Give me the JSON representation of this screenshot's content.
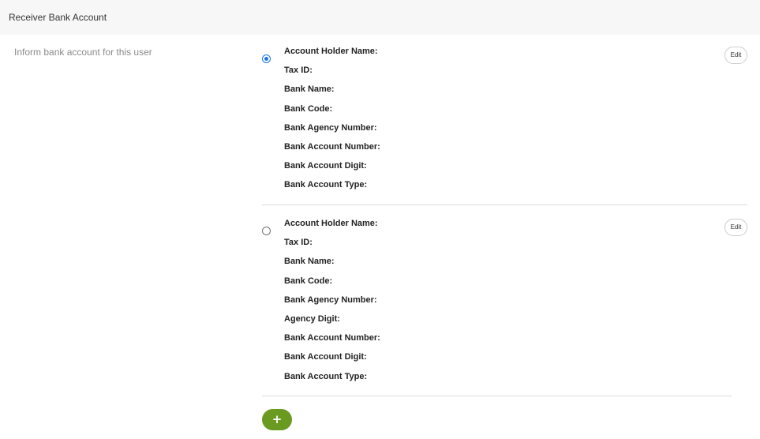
{
  "header": {
    "title": "Receiver Bank Account"
  },
  "section": {
    "description": "Inform bank account for this user"
  },
  "accounts": [
    {
      "selected": true,
      "edit_label": "Edit",
      "fields": [
        "Account Holder Name:",
        "Tax ID:",
        "Bank Name:",
        "Bank Code:",
        "Bank Agency Number:",
        "Bank Account Number:",
        "Bank Account Digit:",
        "Bank Account Type:"
      ]
    },
    {
      "selected": false,
      "edit_label": "Edit",
      "fields": [
        "Account Holder Name:",
        "Tax ID:",
        "Bank Name:",
        "Bank Code:",
        "Bank Agency Number:",
        "Agency Digit:",
        "Bank Account Number:",
        "Bank Account Digit:",
        "Bank Account Type:"
      ]
    }
  ],
  "add_button": {
    "label": "+",
    "color": "#6a9a1f"
  },
  "colors": {
    "header_bg": "#f7f7f7",
    "radio_selected": "#1a73e8",
    "divider": "#dddddd"
  },
  "icons": {
    "add": "plus-icon"
  }
}
